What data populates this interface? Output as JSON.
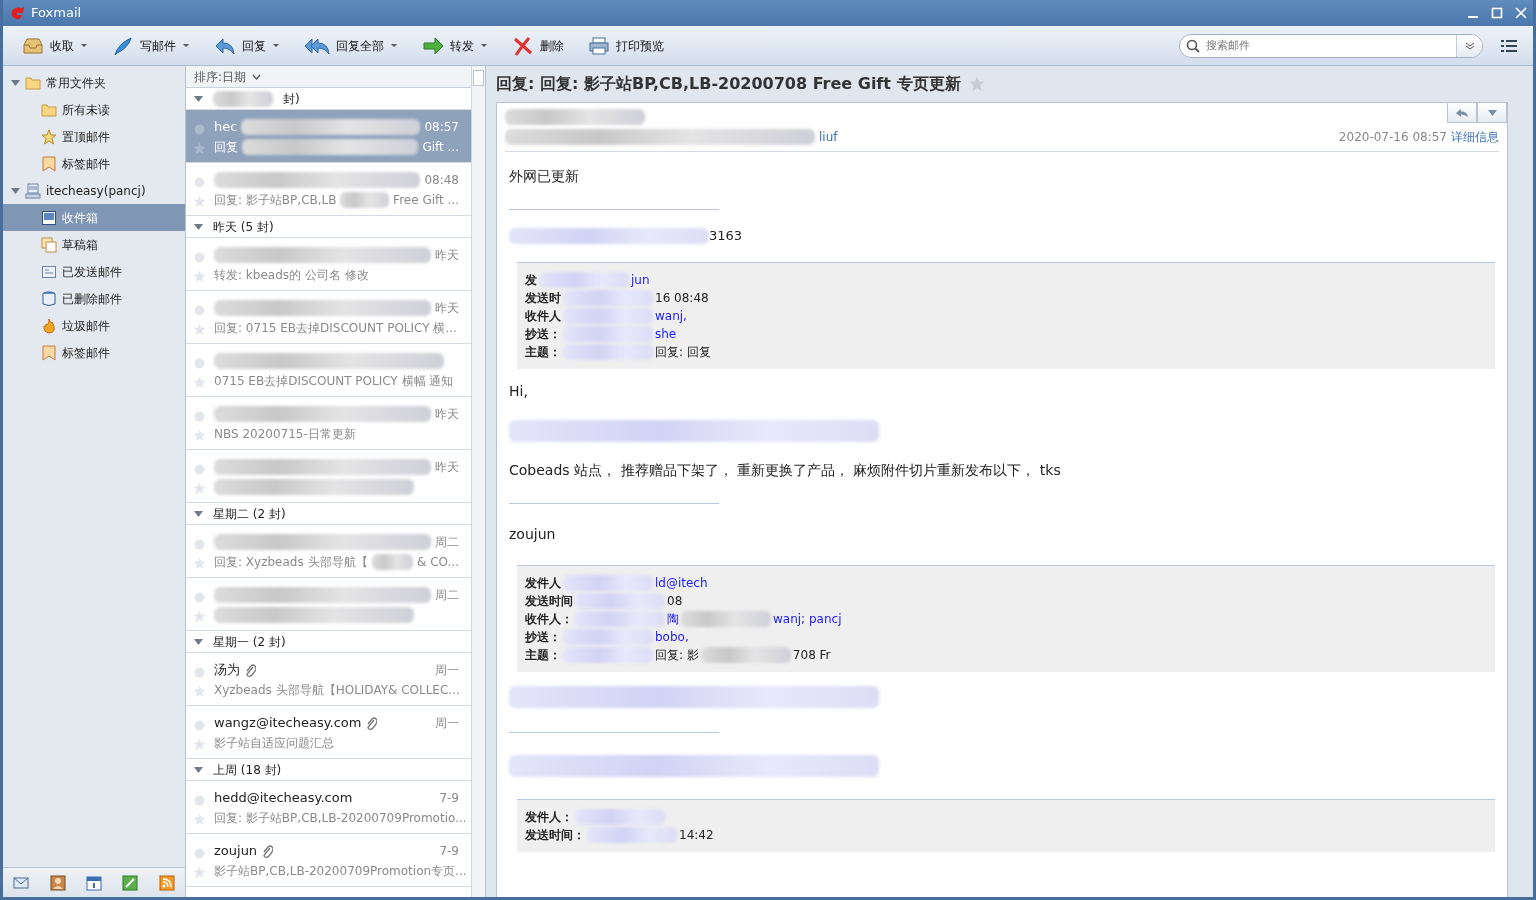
{
  "window": {
    "title": "Foxmail"
  },
  "toolbar": [
    {
      "label": "收取",
      "kind": "receive",
      "dropdown": true
    },
    {
      "label": "写邮件",
      "kind": "compose",
      "dropdown": true
    },
    {
      "label": "回复",
      "kind": "reply",
      "dropdown": true
    },
    {
      "label": "回复全部",
      "kind": "replyall",
      "dropdown": true
    },
    {
      "label": "转发",
      "kind": "forward",
      "dropdown": true
    },
    {
      "label": "删除",
      "kind": "delete",
      "dropdown": false
    },
    {
      "label": "打印预览",
      "kind": "print",
      "dropdown": false
    }
  ],
  "search": {
    "placeholder": "搜索邮件"
  },
  "sidebar": [
    {
      "label": "常用文件夹",
      "kind": "folder",
      "expanded": true,
      "selected": false,
      "children": [
        {
          "label": "所有未读",
          "kind": "folder",
          "selected": false
        },
        {
          "label": "置顶邮件",
          "kind": "star",
          "selected": false
        },
        {
          "label": "标签邮件",
          "kind": "tag",
          "selected": false
        }
      ]
    },
    {
      "label": "itecheasy(pancj)",
      "kind": "account",
      "expanded": true,
      "selected": false,
      "children": [
        {
          "label": "收件箱",
          "kind": "inbox",
          "selected": true
        },
        {
          "label": "草稿箱",
          "kind": "drafts",
          "selected": false
        },
        {
          "label": "已发送邮件",
          "kind": "sent",
          "selected": false
        },
        {
          "label": "已删除邮件",
          "kind": "trash",
          "selected": false
        },
        {
          "label": "垃圾邮件",
          "kind": "junk",
          "selected": false
        },
        {
          "label": "标签邮件",
          "kind": "tag",
          "selected": false
        }
      ]
    }
  ],
  "message_list": {
    "sort_label": "排序:日期",
    "groups": [
      {
        "label": "封)",
        "expanded": true,
        "blurred": true,
        "messages": [
          {
            "sender": "hec",
            "time": "08:57",
            "subject": "回复",
            "subject_tail": "Gift ...",
            "selected": true,
            "unread": false,
            "starred": false,
            "attachment": false,
            "blurred": true
          },
          {
            "time": "08:48",
            "subject": "回复: 影子站BP,CB,LB",
            "subject_tail": "Free Gift ...",
            "selected": false,
            "unread": false,
            "starred": false,
            "attachment": false,
            "blurred": true
          }
        ]
      },
      {
        "label": "昨天 (5 封)",
        "expanded": true,
        "blurred": false,
        "messages": [
          {
            "time": "昨天",
            "subject": "转发: kbeads的 公司名 修改",
            "selected": false,
            "unread": false,
            "starred": false,
            "attachment": false,
            "blurred": true
          },
          {
            "time": "昨天",
            "subject": "回复: 0715 EB去掉DISCOUNT POLICY 横...",
            "selected": false,
            "unread": false,
            "starred": false,
            "attachment": false,
            "blurred": true
          },
          {
            "subject": "0715 EB去掉DISCOUNT POLICY 横幅 通知",
            "selected": false,
            "unread": false,
            "starred": false,
            "attachment": false,
            "blurred": true
          },
          {
            "time": "昨天",
            "subject": "NBS 20200715-日常更新",
            "selected": false,
            "unread": false,
            "starred": false,
            "attachment": false,
            "blurred": true
          },
          {
            "time": "昨天",
            "selected": false,
            "unread": false,
            "starred": false,
            "attachment": false,
            "blurred": true
          }
        ]
      },
      {
        "label": "星期二 (2 封)",
        "expanded": true,
        "blurred": false,
        "messages": [
          {
            "time": "周二",
            "subject": "回复: Xyzbeads 头部导航【",
            "subject_tail": "& CO...",
            "selected": false,
            "unread": false,
            "starred": false,
            "attachment": false,
            "blurred": true
          },
          {
            "time": "周二",
            "selected": false,
            "unread": false,
            "starred": false,
            "attachment": false,
            "blurred": true
          }
        ]
      },
      {
        "label": "星期一 (2 封)",
        "expanded": true,
        "blurred": false,
        "messages": [
          {
            "sender": "汤为",
            "time": "周一",
            "subject": "Xyzbeads 头部导航【HOLIDAY& COLLEC...",
            "selected": false,
            "unread": false,
            "starred": false,
            "attachment": true,
            "blurred": false
          },
          {
            "sender": "wangz@itecheasy.com",
            "time": "周一",
            "subject": "影子站自适应问题汇总",
            "selected": false,
            "unread": false,
            "starred": false,
            "attachment": true,
            "blurred": false
          }
        ]
      },
      {
        "label": "上周 (18 封)",
        "expanded": true,
        "blurred": false,
        "messages": [
          {
            "sender": "hedd@itecheasy.com",
            "time": "7-9",
            "subject": "回复: 影子站BP,CB,LB-20200709Promotio...",
            "selected": false,
            "unread": false,
            "starred": false,
            "attachment": false,
            "blurred": false
          },
          {
            "sender": "zoujun",
            "time": "7-9",
            "subject": "影子站BP,CB,LB-20200709Promotion专页...",
            "selected": false,
            "unread": false,
            "starred": false,
            "attachment": true,
            "blurred": false
          }
        ]
      }
    ]
  },
  "reader": {
    "subject": "回复: 回复: 影子站BP,CB,LB-20200708 Free Gift 专页更新",
    "starred": false,
    "to_fragment": "liuf",
    "date": "2020-07-16 08:57",
    "details_link": "详细信息",
    "body": [
      {
        "kind": "text",
        "text": "外网已更新"
      },
      {
        "kind": "rule"
      },
      {
        "kind": "fragment",
        "text": "3163"
      },
      {
        "kind": "quote",
        "rows": [
          {
            "label": "发",
            "value": "jun",
            "link": true
          },
          {
            "label": "发送时",
            "value": "16 08:48",
            "link": false
          },
          {
            "label": "收件人",
            "value": "wanj,",
            "link": true
          },
          {
            "label": "抄送：",
            "value": "she",
            "link": true
          },
          {
            "label": "主题：",
            "value": "回复: 回复",
            "link": false
          }
        ]
      },
      {
        "kind": "text",
        "text": "Hi,"
      },
      {
        "kind": "blur"
      },
      {
        "kind": "text",
        "text": "Cobeads 站点， 推荐赠品下架了， 重新更换了产品， 麻烦附件切片重新发布以下， tks"
      },
      {
        "kind": "rule"
      },
      {
        "kind": "text",
        "text": "zoujun"
      },
      {
        "kind": "quote",
        "rows": [
          {
            "label": "发件人",
            "value": "ld@itech",
            "link": true
          },
          {
            "label": "发送时间",
            "value": "08",
            "link": false
          },
          {
            "label": "收件人：",
            "value": "陶",
            "value2": "wanj; pancj",
            "link": true
          },
          {
            "label": "抄送：",
            "value": "bobo,",
            "link": true
          },
          {
            "label": "主题：",
            "value": "回复: 影",
            "value2": "708 Fr",
            "link": false
          }
        ]
      },
      {
        "kind": "blur"
      },
      {
        "kind": "rule"
      },
      {
        "kind": "blur"
      },
      {
        "kind": "quote",
        "rows": [
          {
            "label": "发件人："
          },
          {
            "label": "发送时间：",
            "value": "14:42",
            "link": false
          }
        ]
      }
    ]
  }
}
